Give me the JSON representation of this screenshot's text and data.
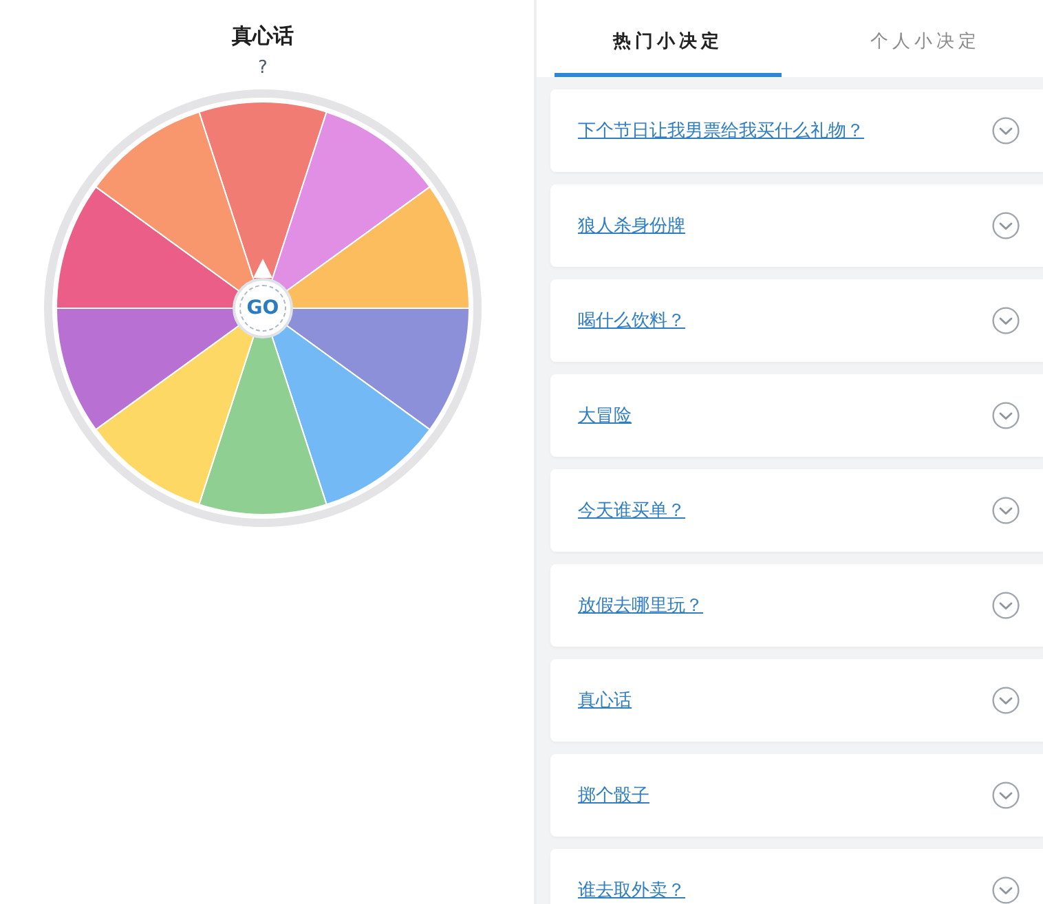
{
  "header": {
    "title": "真心话",
    "subtitle": "?"
  },
  "wheel": {
    "slices": [
      {
        "color": "#f07c74"
      },
      {
        "color": "#e08fe4"
      },
      {
        "color": "#fbbd5e"
      },
      {
        "color": "#8c90d8"
      },
      {
        "color": "#72b9f6"
      },
      {
        "color": "#90cf92"
      },
      {
        "color": "#fdd865"
      },
      {
        "color": "#b870d2"
      },
      {
        "color": "#ea5e88"
      },
      {
        "color": "#f8966e"
      }
    ],
    "spin_button": "GO"
  },
  "tabs": [
    {
      "label": "热门小决定",
      "selected": true
    },
    {
      "label": "个人小决定",
      "selected": false
    }
  ],
  "decisions": [
    {
      "title": "下个节日让我男票给我买什么礼物？"
    },
    {
      "title": "狼人杀身份牌"
    },
    {
      "title": "喝什么饮料？"
    },
    {
      "title": "大冒险"
    },
    {
      "title": "今天谁买单？"
    },
    {
      "title": "放假去哪里玩？"
    },
    {
      "title": "真心话"
    },
    {
      "title": "掷个骰子"
    },
    {
      "title": "谁去取外卖？"
    }
  ]
}
